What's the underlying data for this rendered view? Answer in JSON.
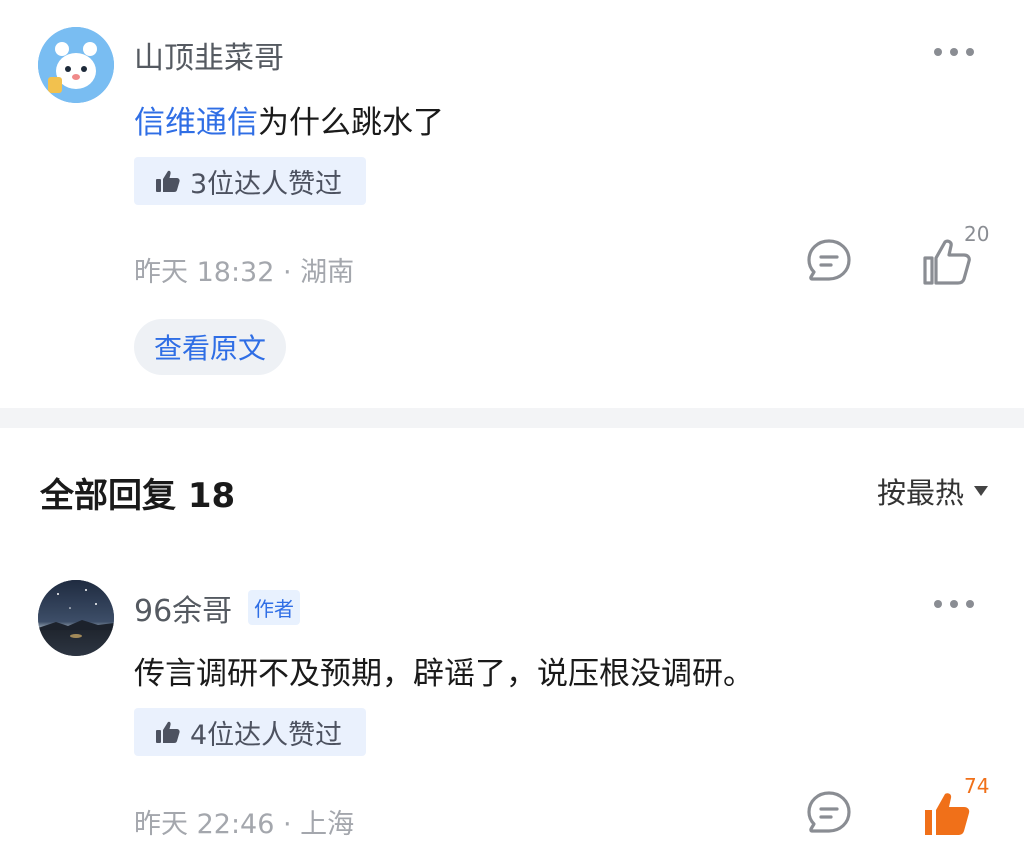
{
  "top_comment": {
    "username": "山顶韭菜哥",
    "body_link": "信维通信",
    "body_rest": "为什么跳水了",
    "expert_likes": "3位达人赞过",
    "meta": "昨天 18:32 · 湖南",
    "like_count": "20",
    "view_original": "查看原文",
    "avatar_icon": "cartoon-mascot-avatar",
    "like_icon": "thumbs-up-outline-icon",
    "reply_icon": "comment-bubble-icon"
  },
  "replies_header": {
    "title": "全部回复 18",
    "sort_label": "按最热"
  },
  "reply": {
    "username": "96余哥",
    "author_badge": "作者",
    "body": "传言调研不及预期，辟谣了，说压根没调研。",
    "expert_likes": "4位达人赞过",
    "meta": "昨天 22:46 · 上海",
    "like_count": "74",
    "avatar_icon": "night-sky-photo-avatar",
    "like_icon": "thumbs-up-filled-icon",
    "reply_icon": "comment-bubble-icon"
  },
  "colors": {
    "link_blue": "#2f6ee5",
    "like_active": "#f07019",
    "meta_gray": "#a4a7ad",
    "badge_bg": "#eaf1fd"
  }
}
